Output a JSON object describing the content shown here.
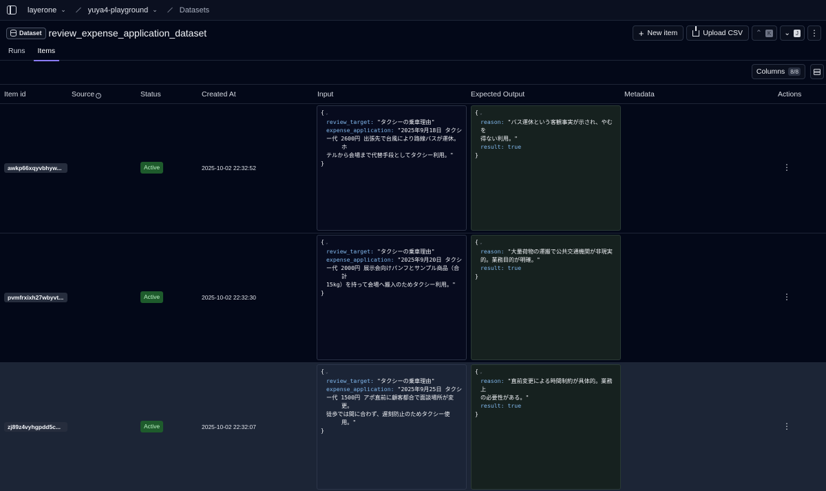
{
  "breadcrumb": {
    "org": "layerone",
    "project": "yuya4-playground",
    "section": "Datasets"
  },
  "header": {
    "badge": "Dataset",
    "title": "review_expense_application_dataset",
    "new_item": "New item",
    "upload_csv": "Upload CSV",
    "kbd_prev": "K",
    "kbd_next": "J"
  },
  "tabs": [
    "Runs",
    "Items"
  ],
  "active_tab": "Items",
  "toolbar": {
    "columns_label": "Columns",
    "columns_count": "8/8"
  },
  "table": {
    "headers": {
      "item_id": "Item id",
      "source": "Source",
      "status": "Status",
      "created_at": "Created At",
      "input": "Input",
      "expected_output": "Expected Output",
      "metadata": "Metadata",
      "actions": "Actions"
    },
    "rows": [
      {
        "id": "awkp66xqyvbhyw...",
        "status": "Active",
        "created": "2025-10-02 22:32:52",
        "input": {
          "review_target": "\"タクシーの乗車理由\"",
          "expense_application_l1": "\"2025年9月18日 タクシ",
          "expense_application_l2": "ー代 2600円 出張先で台風により路線バスが運休。ホ",
          "expense_application_l3": "テルから会場まで代替手段としてタクシー利用。\""
        },
        "output": {
          "reason_l1": "\"バス運休という客観事実が示され、やむを",
          "reason_l2": "得ない利用。\"",
          "result": "true"
        }
      },
      {
        "id": "pvmfrxixh27wbyvt...",
        "status": "Active",
        "created": "2025-10-02 22:32:30",
        "input": {
          "review_target": "\"タクシーの乗車理由\"",
          "expense_application_l1": "\"2025年9月20日 タクシ",
          "expense_application_l2": "ー代 2000円 展示会向けパンフとサンプル商品（合計",
          "expense_application_l3": "15kg）を持って会場へ搬入のためタクシー利用。\""
        },
        "output": {
          "reason_l1": "\"大量荷物の運搬で公共交通機関が非現実",
          "reason_l2": "的。業務目的が明確。\"",
          "result": "true"
        }
      },
      {
        "id": "zj89z4vyhgpdd5c...",
        "status": "Active",
        "created": "2025-10-02 22:32:07",
        "input": {
          "review_target": "\"タクシーの乗車理由\"",
          "expense_application_l1": "\"2025年9月25日 タクシ",
          "expense_application_l2": "ー代 1500円 アポ直前に顧客都合で面談場所が変更。",
          "expense_application_l3": "徒歩では間に合わず、遅刻防止のためタクシー使用。\""
        },
        "output": {
          "reason_l1": "\"直前変更による時間制約が具体的。業務上",
          "reason_l2": "の必要性がある。\"",
          "result": "true"
        }
      }
    ]
  },
  "keys": {
    "review_target": "review_target:",
    "expense_application": "expense_application:",
    "reason": "reason:",
    "result": "result:",
    "open": "{",
    "close": "}"
  },
  "colors": {
    "accent": "#8b7cf6",
    "status_active_bg": "#1e5b2c",
    "status_active_text": "#b9f0c2"
  }
}
